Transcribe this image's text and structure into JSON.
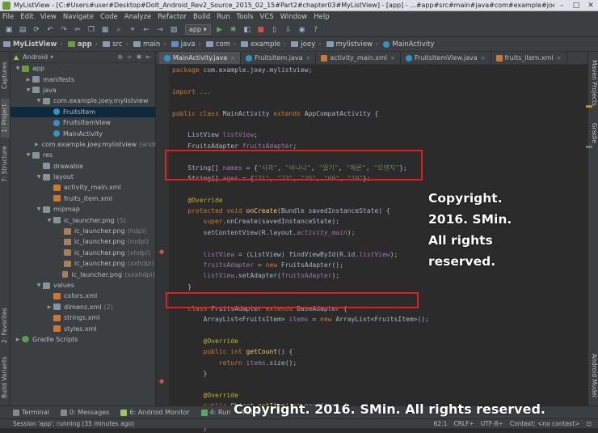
{
  "window": {
    "title": "MyListView - [C:#Users#user#Desktop#DoIt_Android_Rev2_Source_2015_02_15#Part2#chapter03#MyListView] - [app] - ...#app#src#main#java#com#example#joey#mylistview#Main..."
  },
  "menu": [
    "File",
    "Edit",
    "View",
    "Navigate",
    "Code",
    "Analyze",
    "Refactor",
    "Build",
    "Run",
    "Tools",
    "VCS",
    "Window",
    "Help"
  ],
  "toolbar": {
    "run_config": "app ▾"
  },
  "breadcrumb": [
    "MyListView",
    "app",
    "src",
    "main",
    "java",
    "com",
    "example",
    "joey",
    "mylistview",
    "MainActivity"
  ],
  "left_tabs": [
    "1: Project",
    "7: Structure",
    "Captures",
    "2: Favorites",
    "Build Variants"
  ],
  "right_tabs": [
    "Maven Projects",
    "Gradle",
    "Android Model"
  ],
  "project": {
    "view": "Android",
    "tree": [
      {
        "label": "app",
        "indent": 0,
        "icon": "mod",
        "arrow": "▼"
      },
      {
        "label": "manifests",
        "indent": 1,
        "icon": "folder",
        "arrow": "▶"
      },
      {
        "label": "java",
        "indent": 1,
        "icon": "folder",
        "arrow": "▼"
      },
      {
        "label": "com.example.joey.mylistview",
        "indent": 2,
        "icon": "folder",
        "arrow": "▼"
      },
      {
        "label": "FruitsItem",
        "indent": 3,
        "icon": "java",
        "arrow": "",
        "sel": true
      },
      {
        "label": "FruitsItemView",
        "indent": 3,
        "icon": "java",
        "arrow": ""
      },
      {
        "label": "MainActivity",
        "indent": 3,
        "icon": "java",
        "arrow": ""
      },
      {
        "label": "com.example.joey.mylistview",
        "note": "(andro",
        "indent": 2,
        "icon": "folder",
        "arrow": "▶"
      },
      {
        "label": "res",
        "indent": 1,
        "icon": "folder",
        "arrow": "▼"
      },
      {
        "label": "drawable",
        "indent": 2,
        "icon": "folder",
        "arrow": ""
      },
      {
        "label": "layout",
        "indent": 2,
        "icon": "folder",
        "arrow": "▼"
      },
      {
        "label": "activity_main.xml",
        "indent": 3,
        "icon": "xml",
        "arrow": ""
      },
      {
        "label": "fruits_item.xml",
        "indent": 3,
        "icon": "xml",
        "arrow": ""
      },
      {
        "label": "mipmap",
        "indent": 2,
        "icon": "folder",
        "arrow": "▼"
      },
      {
        "label": "ic_launcher.png",
        "note": "(5)",
        "indent": 3,
        "icon": "folder",
        "arrow": "▼"
      },
      {
        "label": "ic_launcher.png",
        "note": "(hdpi)",
        "indent": 4,
        "icon": "png",
        "arrow": ""
      },
      {
        "label": "ic_launcher.png",
        "note": "(mdpi)",
        "indent": 4,
        "icon": "png",
        "arrow": ""
      },
      {
        "label": "ic_launcher.png",
        "note": "(xhdpi)",
        "indent": 4,
        "icon": "png",
        "arrow": ""
      },
      {
        "label": "ic_launcher.png",
        "note": "(xxhdpi)",
        "indent": 4,
        "icon": "png",
        "arrow": ""
      },
      {
        "label": "ic_launcher.png",
        "note": "(xxxhdpi)",
        "indent": 4,
        "icon": "png",
        "arrow": ""
      },
      {
        "label": "values",
        "indent": 2,
        "icon": "folder",
        "arrow": "▼"
      },
      {
        "label": "colors.xml",
        "indent": 3,
        "icon": "xml",
        "arrow": ""
      },
      {
        "label": "dimens.xml",
        "note": "(2)",
        "indent": 3,
        "icon": "folder",
        "arrow": "▶"
      },
      {
        "label": "strings.xml",
        "indent": 3,
        "icon": "xml",
        "arrow": ""
      },
      {
        "label": "styles.xml",
        "indent": 3,
        "icon": "xml",
        "arrow": ""
      },
      {
        "label": "Gradle Scripts",
        "indent": 0,
        "icon": "gradle",
        "arrow": "▶"
      }
    ]
  },
  "tabs": [
    {
      "label": "MainActivity.java",
      "type": "java",
      "active": true
    },
    {
      "label": "FruitsItem.java",
      "type": "java"
    },
    {
      "label": "activity_main.xml",
      "type": "xml"
    },
    {
      "label": "FruitsItemView.java",
      "type": "java"
    },
    {
      "label": "fruits_item.xml",
      "type": "xml"
    }
  ],
  "code": [
    [
      [
        "kw",
        "package "
      ],
      [
        "pl",
        "com.example.joey.mylistview;"
      ]
    ],
    [],
    [
      [
        "kw",
        "import "
      ],
      [
        "cm",
        "..."
      ]
    ],
    [],
    [
      [
        "kw",
        "public class "
      ],
      [
        "pl",
        "MainActivity "
      ],
      [
        "kw",
        "extends "
      ],
      [
        "pl",
        "AppCompatActivity {"
      ]
    ],
    [],
    [
      [
        "pl",
        "    ListView "
      ],
      [
        "fld",
        "listView"
      ],
      [
        "pl",
        ";"
      ]
    ],
    [
      [
        "pl",
        "    FruitsAdapter "
      ],
      [
        "fld",
        "fruitsAdapter"
      ],
      [
        "pl",
        ";"
      ]
    ],
    [],
    [
      [
        "pl",
        "    String[] "
      ],
      [
        "fld",
        "names"
      ],
      [
        "pl",
        " = {"
      ],
      [
        "str",
        "\"사과\""
      ],
      [
        "pl",
        ", "
      ],
      [
        "str",
        "\"바나나\""
      ],
      [
        "pl",
        ", "
      ],
      [
        "str",
        "\"딸기\""
      ],
      [
        "pl",
        ", "
      ],
      [
        "str",
        "\"메론\""
      ],
      [
        "pl",
        ", "
      ],
      [
        "str",
        "\"오렌지\""
      ],
      [
        "pl",
        "};"
      ]
    ],
    [
      [
        "pl",
        "    String[] "
      ],
      [
        "fld",
        "ages"
      ],
      [
        "pl",
        " = {"
      ],
      [
        "str",
        "\"21\""
      ],
      [
        "pl",
        ", "
      ],
      [
        "str",
        "\"23\""
      ],
      [
        "pl",
        ", "
      ],
      [
        "str",
        "\"25\""
      ],
      [
        "pl",
        ", "
      ],
      [
        "str",
        "\"60\""
      ],
      [
        "pl",
        ", "
      ],
      [
        "str",
        "\"10\""
      ],
      [
        "pl",
        "};"
      ]
    ],
    [],
    [
      [
        "ann",
        "    @Override"
      ]
    ],
    [
      [
        "kw",
        "    protected void "
      ],
      [
        "fn",
        "onCreate"
      ],
      [
        "pl",
        "(Bundle savedInstanceState) {"
      ]
    ],
    [
      [
        "kw",
        "        super"
      ],
      [
        "pl",
        ".onCreate(savedInstanceState);"
      ]
    ],
    [
      [
        "pl",
        "        setContentView(R.layout."
      ],
      [
        "fld it",
        "activity_main"
      ],
      [
        "pl",
        ");"
      ]
    ],
    [],
    [
      [
        "fld",
        "        listView"
      ],
      [
        "pl",
        " = (ListView) findViewById(R.id."
      ],
      [
        "fld it",
        "listView"
      ],
      [
        "pl",
        ");"
      ]
    ],
    [
      [
        "fld",
        "        fruitsAdapter"
      ],
      [
        "pl",
        " = "
      ],
      [
        "kw",
        "new "
      ],
      [
        "pl",
        "FruitsAdapter();"
      ]
    ],
    [
      [
        "fld",
        "        listView"
      ],
      [
        "pl",
        ".setAdapter("
      ],
      [
        "fld",
        "fruitsAdapter"
      ],
      [
        "pl",
        ");"
      ]
    ],
    [
      [
        "pl",
        "    }"
      ]
    ],
    [],
    [
      [
        "kw",
        "    class "
      ],
      [
        "pl",
        "FruitsAdapter "
      ],
      [
        "kw",
        "extends "
      ],
      [
        "pl",
        "BaseAdapter {"
      ]
    ],
    [
      [
        "pl",
        "        ArrayList<FruitsItem> "
      ],
      [
        "fld",
        "items"
      ],
      [
        "pl",
        " = "
      ],
      [
        "kw",
        "new "
      ],
      [
        "pl",
        "ArrayList<FruitsItem>();"
      ]
    ],
    [],
    [
      [
        "ann",
        "        @Override"
      ]
    ],
    [
      [
        "kw",
        "        public int "
      ],
      [
        "fn",
        "getCount"
      ],
      [
        "pl",
        "() {"
      ]
    ],
    [
      [
        "kw",
        "            return "
      ],
      [
        "fld",
        "items"
      ],
      [
        "pl",
        ".size();"
      ]
    ],
    [
      [
        "pl",
        "        }"
      ]
    ],
    [],
    [
      [
        "ann",
        "        @Override"
      ]
    ],
    [
      [
        "kw",
        "        public "
      ],
      [
        "pl",
        "Object "
      ],
      [
        "fn",
        "getItem"
      ],
      [
        "pl",
        "("
      ],
      [
        "kw",
        "int "
      ],
      [
        "pl",
        "position) {"
      ]
    ],
    [
      [
        "kw",
        "            return "
      ],
      [
        "fld",
        "items"
      ],
      [
        "pl",
        ".get(position);"
      ]
    ],
    [
      [
        "pl",
        "        }"
      ]
    ]
  ],
  "watermark": {
    "side_lines": [
      "Copyright.",
      "2016. SMin.",
      "All rights",
      "reserved."
    ],
    "bottom": "Copyright. 2016. SMin. All rights reserved."
  },
  "toolwindows": [
    "Terminal",
    "0: Messages",
    "6: Android Monitor",
    "4: Run",
    "TODO"
  ],
  "status": {
    "left": "Session 'app': running (35 minutes ago)",
    "pos": "62:1",
    "crlf": "CRLF÷",
    "enc": "UTF-8÷",
    "ctx": "Context: <no context>"
  },
  "colors": {
    "highlight_box": "#e02020",
    "bg": "#2b2b2b",
    "panel": "#3c3f41"
  }
}
